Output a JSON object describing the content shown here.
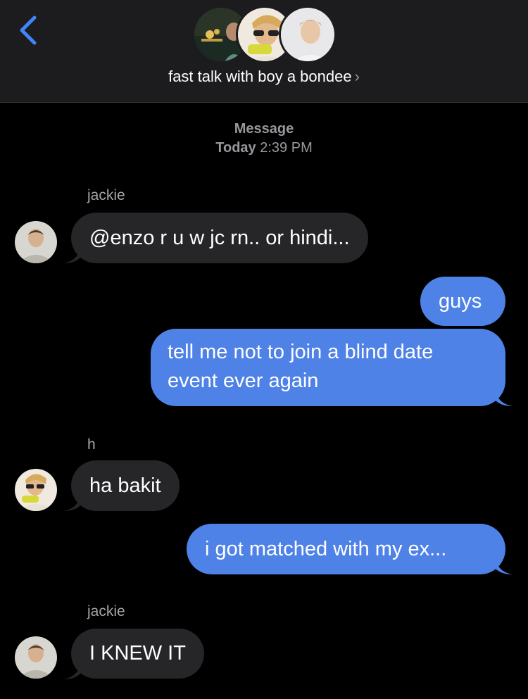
{
  "header": {
    "group_name": "fast talk with boy a bondee",
    "chevron": "›",
    "back_icon": "chevron-left-icon",
    "colors": {
      "accent": "#3e86f7",
      "bar": "#1c1c1e"
    }
  },
  "timestamp": {
    "label": "Message",
    "day": "Today",
    "time": "2:39 PM"
  },
  "messages": [
    {
      "sender": "jackie",
      "text": "@enzo r u w jc rn.. or hindi...",
      "direction": "incoming"
    },
    {
      "text": "guys",
      "direction": "outgoing"
    },
    {
      "text": "tell me not to join a blind date event ever again",
      "direction": "outgoing"
    },
    {
      "sender": "h",
      "text": "ha bakit",
      "direction": "incoming"
    },
    {
      "text": "i got matched with my ex...",
      "direction": "outgoing"
    },
    {
      "sender": "jackie",
      "text": "I KNEW IT",
      "direction": "incoming"
    }
  ],
  "colors": {
    "incoming": "#262628",
    "outgoing": "#4f82e6"
  }
}
